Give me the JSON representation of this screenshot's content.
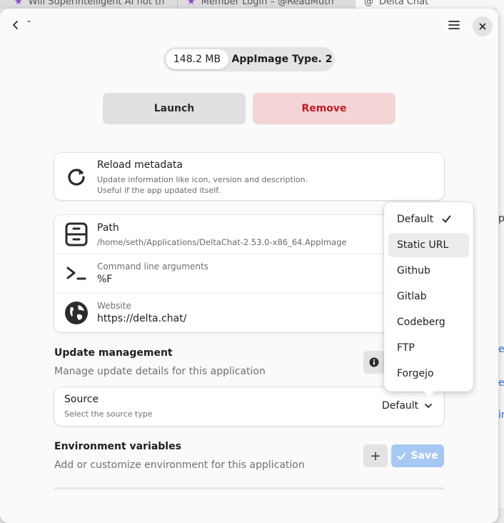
{
  "browser_tabs": [
    {
      "label": "Will Superintelligent AI not th"
    },
    {
      "label": "Member Login – @ReadMuth"
    },
    {
      "label": "Delta Chat"
    }
  ],
  "background_fragments": [
    "p",
    "er",
    "es",
    "ir"
  ],
  "header": {
    "title": "-"
  },
  "badges": {
    "size": "148.2 MB",
    "type": "AppImage Type. 2"
  },
  "actions": {
    "launch": "Launch",
    "remove": "Remove"
  },
  "reload": {
    "title": "Reload metadata",
    "description_line1": "Update information like icon, version and description.",
    "description_line2": "Useful if the app updated itself."
  },
  "details": {
    "path_title": "Path",
    "path_value": "/home/seth/Applications/DeltaChat-2.53.0-x86_64.AppImage",
    "args_caption": "Command line arguments",
    "args_value": "%F",
    "website_caption": "Website",
    "website_value": "https://delta.chat/"
  },
  "update_management": {
    "title": "Update management",
    "subtitle": "Manage update details for this application",
    "source_title": "Source",
    "source_subtitle": "Select the source type",
    "source_value": "Default"
  },
  "dropdown": {
    "options": [
      "Default",
      "Static URL",
      "Github",
      "Gitlab",
      "Codeberg",
      "FTP",
      "Forgejo"
    ],
    "selected": "Default",
    "hovered": "Static URL"
  },
  "environment": {
    "title": "Environment variables",
    "subtitle": "Add or customize environment for this application",
    "add_label": "+",
    "save_label": "Save"
  },
  "colors": {
    "accent": "#a6c8f3",
    "destructive": "#c01c28",
    "destructive_bg": "#f3d5d6"
  }
}
